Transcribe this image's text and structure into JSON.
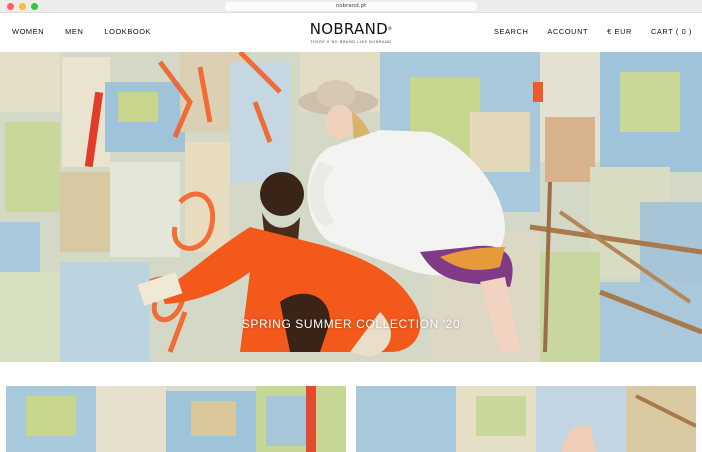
{
  "browser": {
    "url": "nobrand.pt"
  },
  "header": {
    "nav_left": [
      {
        "label": "WOMEN"
      },
      {
        "label": "MEN"
      },
      {
        "label": "LOOKBOOK"
      }
    ],
    "logo": {
      "name": "NOBRAND",
      "tagline": "THERE'S NO BRAND LIKE NOBRAND"
    },
    "nav_right": [
      {
        "label": "SEARCH"
      },
      {
        "label": "ACCOUNT"
      },
      {
        "label": "€ EUR"
      },
      {
        "label": "CART ( 0 )"
      }
    ]
  },
  "hero": {
    "title": "SPRING SUMMER COLLECTION '20"
  },
  "colors": {
    "accent_orange": "#f4591c",
    "text": "#111111",
    "map_blue": "#a9c9dc",
    "map_green": "#c7d58d"
  }
}
